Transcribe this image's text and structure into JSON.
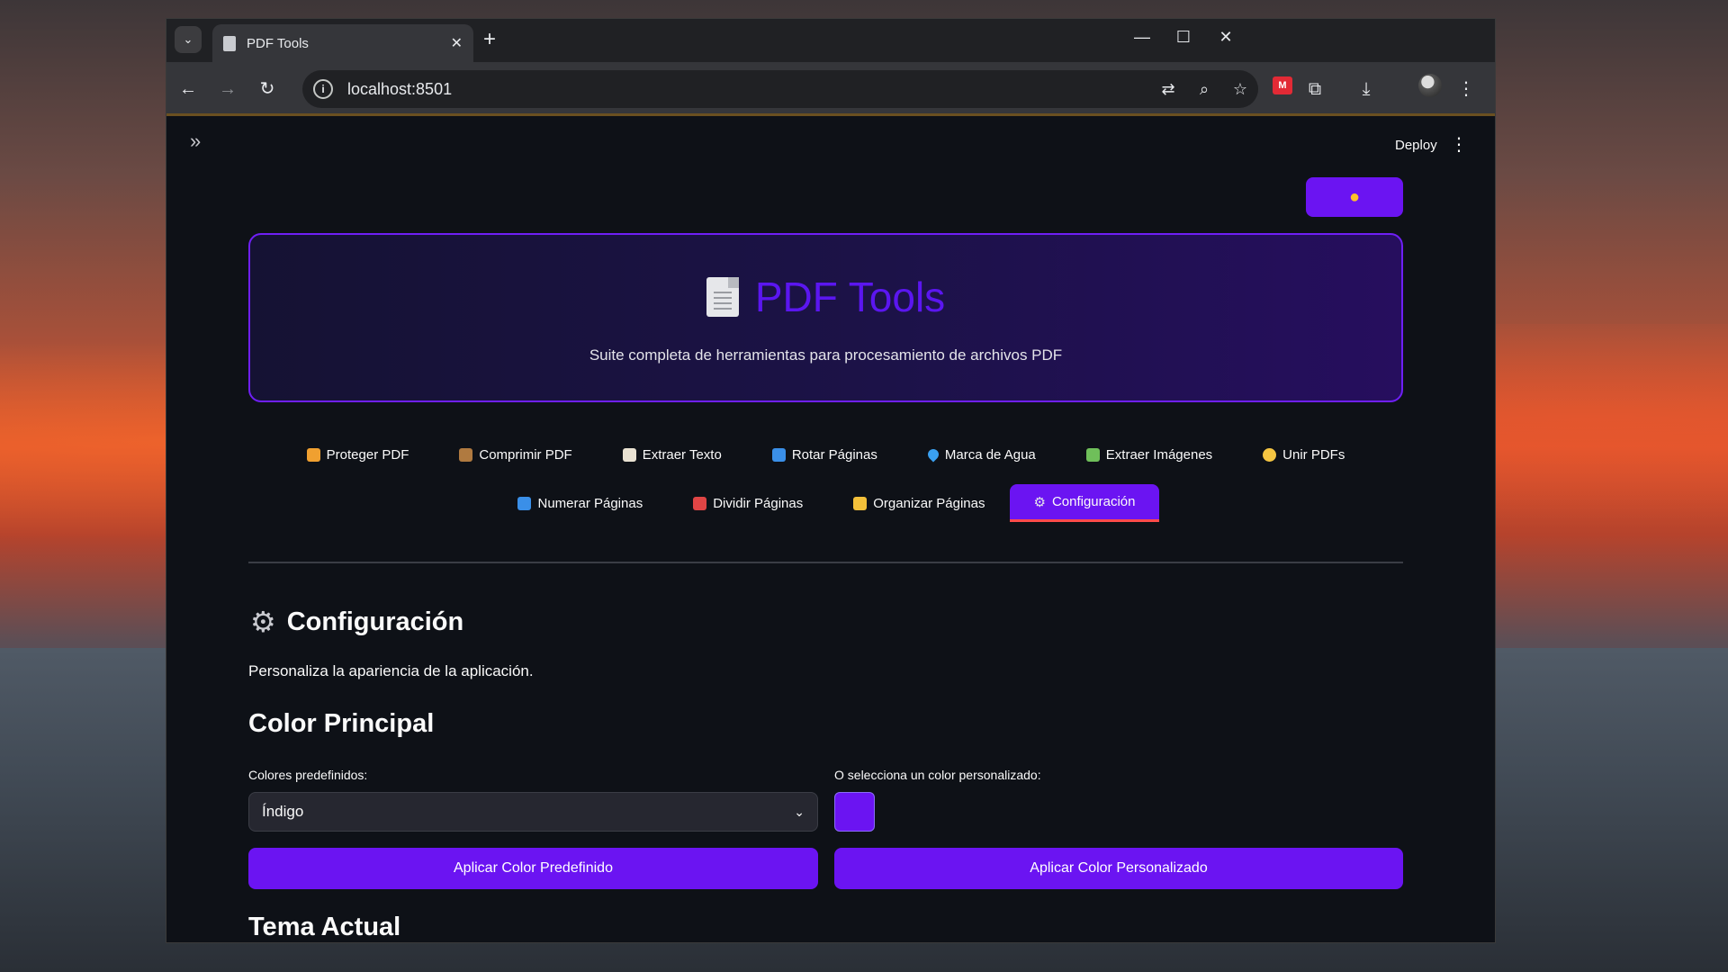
{
  "browser": {
    "tab_title": "PDF Tools",
    "url": "localhost:8501"
  },
  "app": {
    "deploy_label": "Deploy",
    "theme_toggle_icon": "sun-icon",
    "hero": {
      "title": "PDF Tools",
      "subtitle": "Suite completa de herramientas para procesamiento de archivos PDF"
    },
    "tabs_row1": [
      {
        "label": "Proteger PDF",
        "icon": "lock-icon",
        "color": "#f0a030"
      },
      {
        "label": "Comprimir PDF",
        "icon": "package-icon",
        "color": "#b07a40"
      },
      {
        "label": "Extraer Texto",
        "icon": "document-icon",
        "color": "#e9e2d2"
      },
      {
        "label": "Rotar Páginas",
        "icon": "rotate-icon",
        "color": "#3a8fe8"
      },
      {
        "label": "Marca de Agua",
        "icon": "droplet-icon",
        "color": "#3aa0f0"
      },
      {
        "label": "Extraer Imágenes",
        "icon": "image-icon",
        "color": "#6fbf5a"
      },
      {
        "label": "Unir PDFs",
        "icon": "heart-icon",
        "color": "#f5c542"
      }
    ],
    "tabs_row2": [
      {
        "label": "Numerar Páginas",
        "icon": "numbers-icon",
        "color": "#3a8fe8"
      },
      {
        "label": "Dividir Páginas",
        "icon": "scissors-icon",
        "color": "#e04545"
      },
      {
        "label": "Organizar Páginas",
        "icon": "folder-icon",
        "color": "#f3c03a"
      },
      {
        "label": "Configuración",
        "icon": "gear-icon",
        "color": "#c9cad0",
        "active": true
      }
    ],
    "section": {
      "title": "Configuración",
      "description": "Personaliza la apariencia de la aplicación.",
      "color_heading": "Color Principal",
      "preset_label": "Colores predefinidos:",
      "preset_value": "Índigo",
      "custom_label": "O selecciona un color personalizado:",
      "custom_color": "#6b14f2",
      "apply_preset": "Aplicar Color Predefinido",
      "apply_custom": "Aplicar Color Personalizado",
      "theme_heading": "Tema Actual"
    }
  }
}
